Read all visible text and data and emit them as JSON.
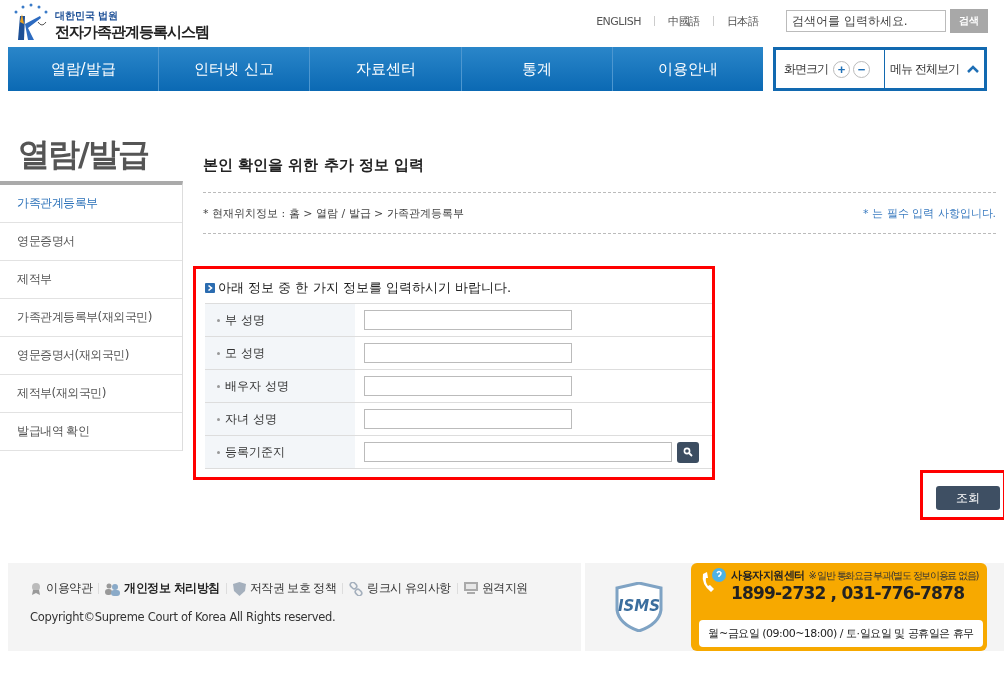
{
  "header": {
    "logo_subtitle": "대한민국 법원",
    "logo_title": "전자가족관계등록시스템",
    "languages": [
      "ENGLISH",
      "中國語",
      "日本語"
    ],
    "search": {
      "placeholder": "검색어를 입력하세요.",
      "button": "검색"
    }
  },
  "nav": {
    "items": [
      "열람/발급",
      "인터넷 신고",
      "자료센터",
      "통계",
      "이용안내"
    ],
    "font_size_label": "화면크기",
    "zoom_in": "+",
    "zoom_out": "−",
    "all_menu": "메뉴 전체보기"
  },
  "sidebar": {
    "title": "열람/발급",
    "items": [
      {
        "label": "가족관계등록부",
        "selected": true
      },
      {
        "label": "영문증명서",
        "selected": false
      },
      {
        "label": "제적부",
        "selected": false
      },
      {
        "label": "가족관계등록부(재외국민)",
        "selected": false
      },
      {
        "label": "영문증명서(재외국민)",
        "selected": false
      },
      {
        "label": "제적부(재외국민)",
        "selected": false
      },
      {
        "label": "발급내역 확인",
        "selected": false
      }
    ]
  },
  "page": {
    "title": "본인 확인을 위한 추가 정보 입력",
    "breadcrumb": "* 현재위치정보 : 홈 > 열람 / 발급 > 가족관계등록부",
    "required_note": "* 는 필수 입력 사항입니다."
  },
  "form": {
    "instruction": "아래 정보 중 한 가지 정보를 입력하시기 바랍니다.",
    "fields": [
      {
        "label": "부 성명",
        "kind": "text"
      },
      {
        "label": "모 성명",
        "kind": "text"
      },
      {
        "label": "배우자 성명",
        "kind": "text"
      },
      {
        "label": "자녀 성명",
        "kind": "text"
      },
      {
        "label": "등록기준지",
        "kind": "search"
      }
    ],
    "submit": "조회"
  },
  "footer": {
    "links": [
      {
        "label": "이용약관",
        "kind": "award",
        "bold": false
      },
      {
        "label": "개인정보 처리방침",
        "kind": "people",
        "bold": true
      },
      {
        "label": "저작권 보호 정책",
        "kind": "shield",
        "bold": false
      },
      {
        "label": "링크시 유의사항",
        "kind": "link",
        "bold": false
      },
      {
        "label": "원격지원",
        "kind": "monitor",
        "bold": false
      }
    ],
    "copyright": "Copyright©Supreme Court of Korea All Rights reserved.",
    "badge": "ISMS",
    "support": {
      "title": "사용자지원센터",
      "note": "※ 일반 통화요금 부과(별도 정보이용료 없음)",
      "phone": "1899-2732 , 031-776-7878",
      "hours": "월~금요일 (09:00~18:00) / 토·일요일 및 공휴일은 휴무"
    }
  }
}
